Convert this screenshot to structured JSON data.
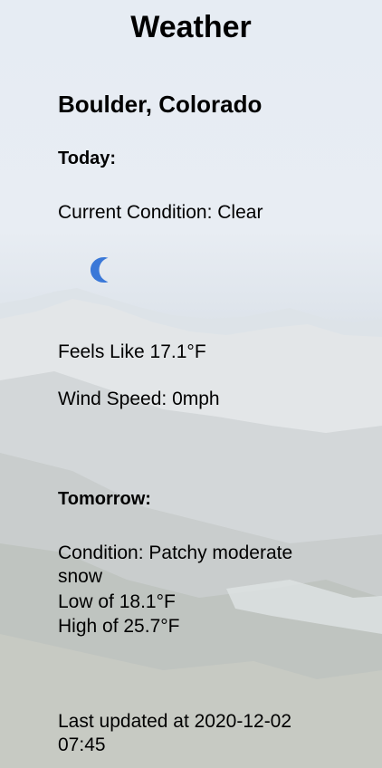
{
  "page": {
    "title": "Weather",
    "location": "Boulder, Colorado"
  },
  "today": {
    "heading": "Today:",
    "condition": "Current Condition: Clear",
    "icon": "moon-icon",
    "feels_like": "Feels Like 17.1°F",
    "wind_speed": "Wind Speed: 0mph"
  },
  "tomorrow": {
    "heading": "Tomorrow:",
    "condition": "Condition: Patchy moderate snow",
    "low": "Low of 18.1°F",
    "high": "High of 25.7°F"
  },
  "footer": {
    "last_updated": "Last updated at 2020-12-02 07:45"
  },
  "colors": {
    "icon": "#3a78d8",
    "text": "#000000"
  }
}
